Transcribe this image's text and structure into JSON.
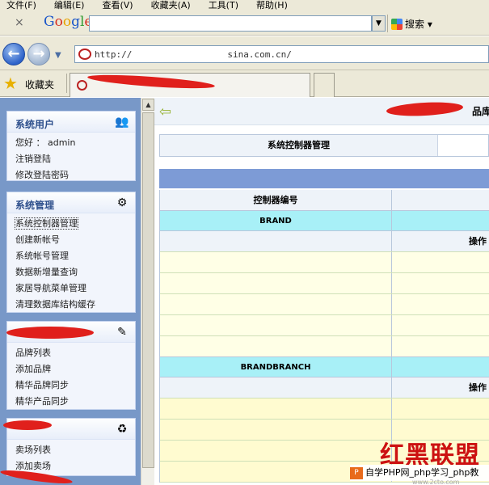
{
  "menu": [
    "文件(F)",
    "编辑(E)",
    "查看(V)",
    "收藏夹(A)",
    "工具(T)",
    "帮助(H)"
  ],
  "toolbar": {
    "close_glyph": "×",
    "google_logo": "Google",
    "search_button": "搜索 ▾"
  },
  "address": {
    "url_prefix": "http://",
    "url_domain": "sina.com.cn/"
  },
  "favorites": {
    "label": "收藏夹"
  },
  "sidebar": {
    "panels": [
      {
        "title": "系统用户",
        "items": [
          "您好 ： admin",
          "注销登陆",
          "修改登陆密码"
        ]
      },
      {
        "title": "系统管理",
        "items": [
          "系统控制器管理",
          "创建新帐号",
          "系统帐号管理",
          "数据新增量查询",
          "家居导航菜单管理",
          "清理数据库结构缓存"
        ]
      },
      {
        "title": "",
        "items": [
          "品牌列表",
          "添加品牌",
          "精华品牌同步",
          "精华产品同步"
        ]
      },
      {
        "title": "",
        "items": [
          "卖场列表",
          "添加卖场"
        ]
      }
    ]
  },
  "main": {
    "page_title": "系统控制器管理",
    "header_partial": "品库",
    "table": {
      "col1_header": "控制器编号",
      "groups": [
        {
          "code": "BRAND",
          "op_label": "操作"
        },
        {
          "code": "BRANDBRANCH",
          "op_label": "操作"
        }
      ]
    }
  },
  "watermark": {
    "big": "红黑联盟",
    "strip": "自学PHP网_php学习_php教",
    "sub": "www.2cto.com"
  }
}
